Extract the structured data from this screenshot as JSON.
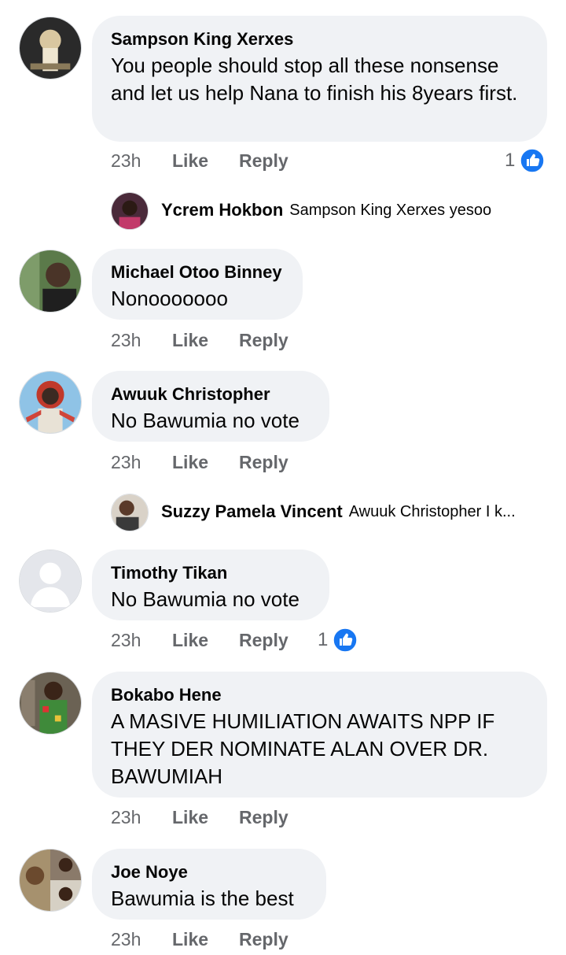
{
  "comments": [
    {
      "author": "Sampson King Xerxes",
      "text": "You people should stop all these nonsense and let us help Nana to finish his 8years first.",
      "time": "23h",
      "like_label": "Like",
      "reply_label": "Reply",
      "reactions": "1",
      "reply": {
        "author": "Ycrem Hokbon",
        "text": "Sampson King Xerxes yesoo"
      }
    },
    {
      "author": "Michael Otoo Binney",
      "text": "Nonooooooo",
      "time": "23h",
      "like_label": "Like",
      "reply_label": "Reply"
    },
    {
      "author": "Awuuk Christopher",
      "text": "No Bawumia no vote",
      "time": "23h",
      "like_label": "Like",
      "reply_label": "Reply",
      "reply": {
        "author": "Suzzy Pamela Vincent",
        "text": "Awuuk Christopher I k..."
      }
    },
    {
      "author": "Timothy Tikan",
      "text": "No Bawumia no vote",
      "time": "23h",
      "like_label": "Like",
      "reply_label": "Reply",
      "reactions": "1"
    },
    {
      "author": "Bokabo Hene",
      "text": "A MASIVE HUMILIATION AWAITS NPP IF THEY DER NOMINATE ALAN OVER DR. BAWUMIAH",
      "time": "23h",
      "like_label": "Like",
      "reply_label": "Reply"
    },
    {
      "author": "Joe Noye",
      "text": "Bawumia is the best",
      "time": "23h",
      "like_label": "Like",
      "reply_label": "Reply"
    }
  ],
  "colors": {
    "bubble": "#f0f2f5",
    "muted": "#65676b",
    "like_blue": "#1877f2"
  }
}
